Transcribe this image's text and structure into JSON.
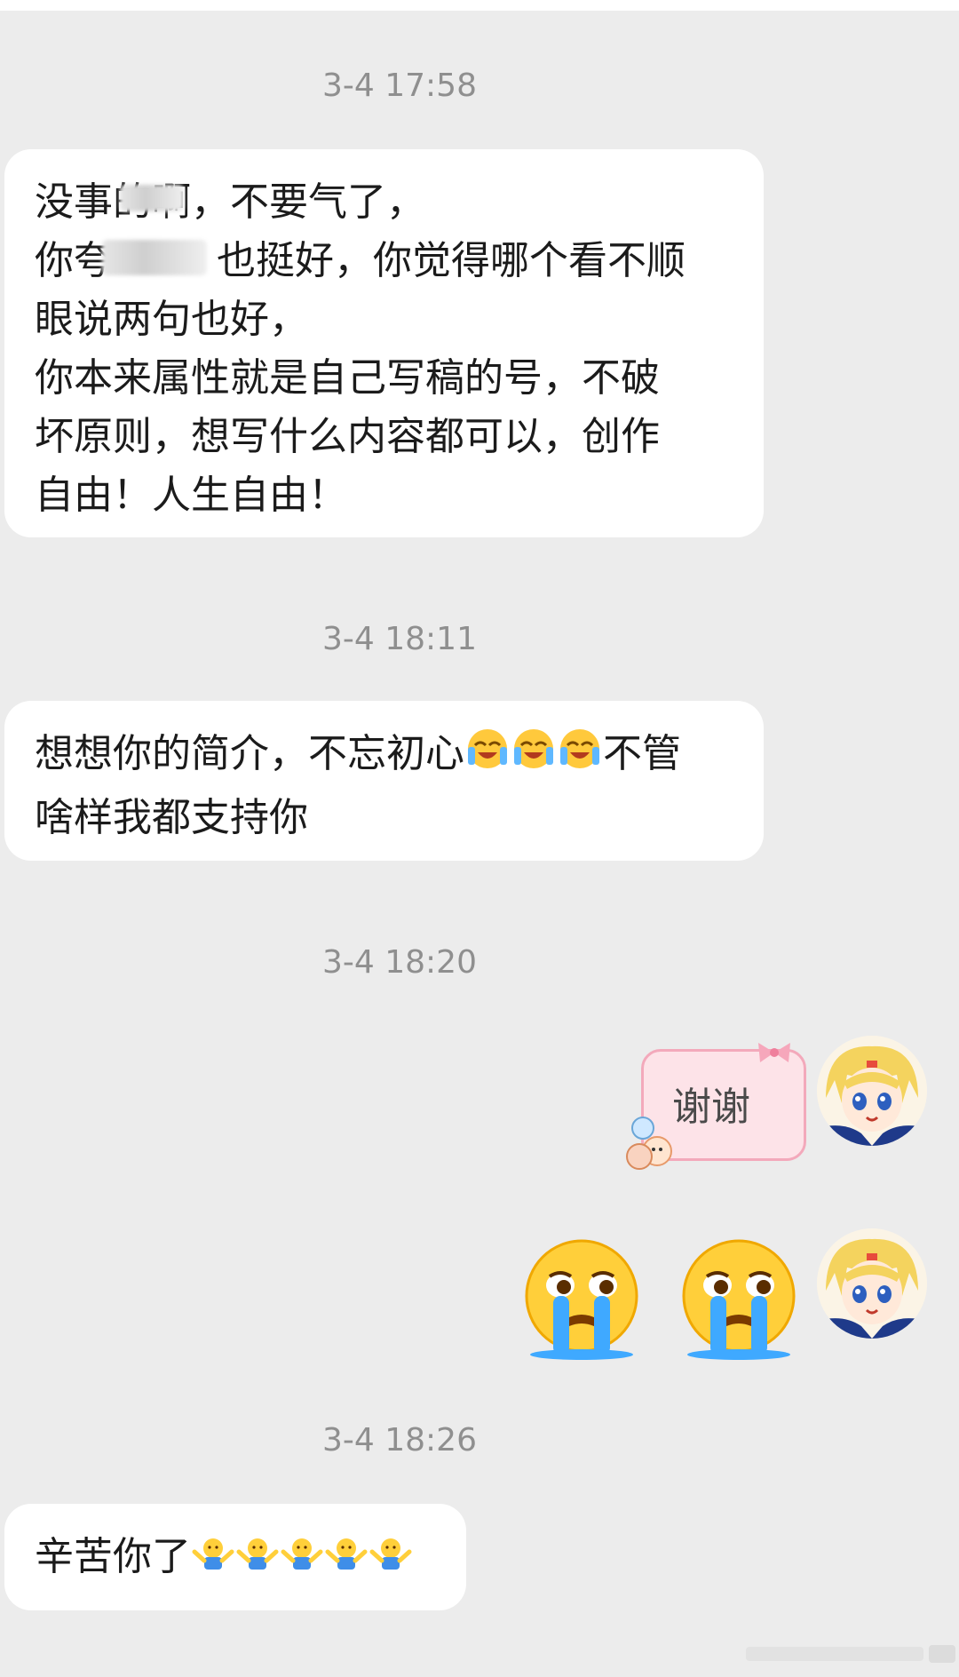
{
  "timestamps": [
    "3-4 17:58",
    "3-4 18:11",
    "3-4 18:20",
    "3-4 18:26"
  ],
  "msg1": {
    "lines": [
      "没事的啊，不要气了，",
      "你夸",
      "也挺好，你觉得哪个看不顺",
      "眼说两句也好，",
      "你本来属性就是自己写稿的号，不破",
      "坏原则，想写什么内容都可以，创作",
      "自由！人生自由！"
    ],
    "line1_prefix": "没事的",
    "line1_rest": "啊，不要气了，"
  },
  "msg2": {
    "part1": "想想你的简介，不忘初心",
    "part2": "不管",
    "line2": "啥样我都支持你"
  },
  "msg3": {
    "text": "谢谢"
  },
  "msg5": {
    "text": "辛苦你了"
  },
  "colors": {
    "background": "#ececec",
    "bubble": "#ffffff",
    "timestamp": "#8f8f8f",
    "pink_bubble": "#fde3e8",
    "pink_border": "#f3a9bb"
  },
  "icons": {
    "crying_laugh": "laughing-crying-emoji-icon",
    "big_cry": "loudly-crying-emoji-icon",
    "shrug": "shrugging-figure-emoji-icon",
    "avatar": "anime-girl-avatar"
  }
}
